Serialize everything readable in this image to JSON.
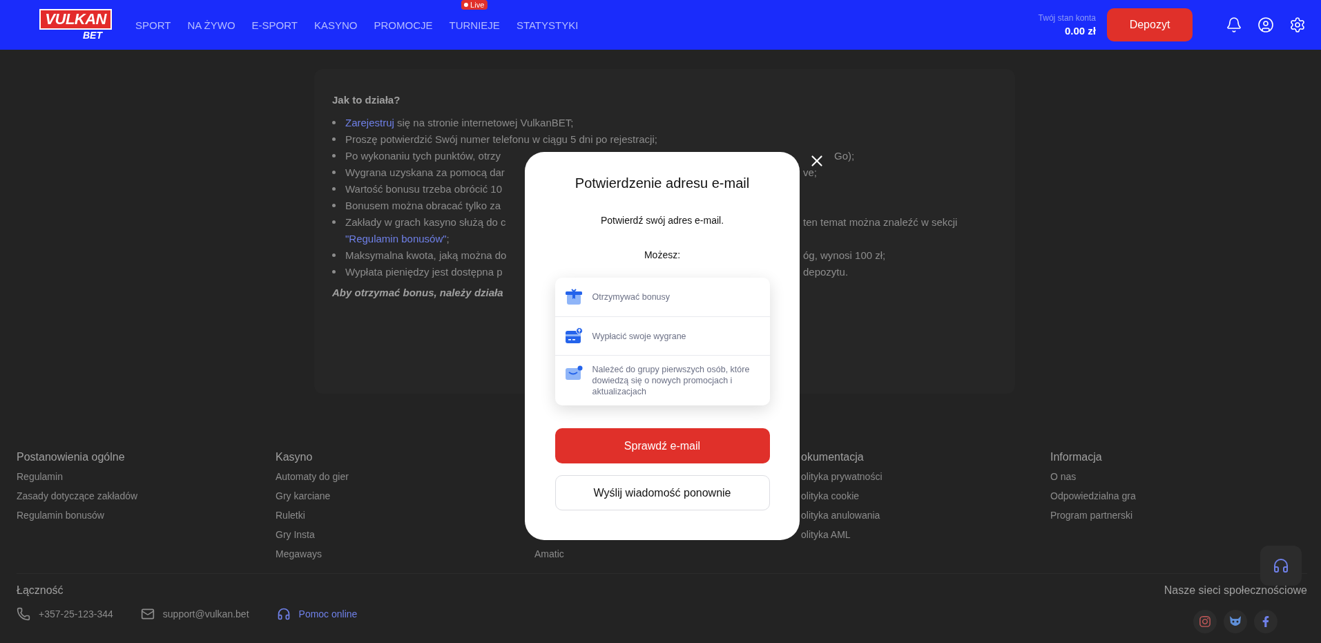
{
  "header": {
    "logo": {
      "wordmark": "VULKAN",
      "subtext": "BET"
    },
    "nav": [
      {
        "label": "SPORT"
      },
      {
        "label": "NA ŻYWO"
      },
      {
        "label": "E-SPORT"
      },
      {
        "label": "KASYNO"
      },
      {
        "label": "PROMOCJE"
      },
      {
        "label": "TURNIEJE",
        "badge": "Live"
      },
      {
        "label": "STATYSTYKI"
      }
    ],
    "balance": {
      "label": "Twój stan konta",
      "amount": "0.00 zł"
    },
    "deposit_button": "Depozyt"
  },
  "promo": {
    "heading": "Jak to działa?",
    "bullets": [
      {
        "link": "Zarejestruj",
        "text": " się na stronie internetowej VulkanBET;"
      },
      {
        "text": "Proszę potwierdzić Swój numer telefonu w ciągu 5 dni po rejestracji;"
      },
      {
        "text": "Po wykonaniu tych punktów, otrzy",
        "right": "Go);"
      },
      {
        "text": "Wygrana uzyskana za pomocą dar",
        "right": "ve;"
      },
      {
        "text": "Wartość bonusu trzeba obrócić 10"
      },
      {
        "text": "Bonusem można obracać tylko za"
      },
      {
        "text": "Zakłady w grach kasyno służą do c",
        "right": "ten temat można znaleźć w sekcji",
        "continuation": {
          "link": "\"Regulamin bonusów\"",
          "text": ";"
        }
      },
      {
        "text": "Maksymalna kwota, jaką można do",
        "right": "óg, wynosi 100 zł;"
      },
      {
        "text": "Wypłata pieniędzy jest dostępna p",
        "right": "depozytu."
      }
    ],
    "note": "Aby otrzymać bonus, należy działa"
  },
  "footer": {
    "columns": [
      {
        "heading": "Postanowienia ogólne",
        "items": [
          "Regulamin",
          "Zasady dotyczące zakładów",
          "Regulamin bonusów"
        ]
      },
      {
        "heading": "Kasyno",
        "items": [
          "Automaty do gier",
          "Gry karciane",
          "Ruletki",
          "Gry Insta",
          "Megaways"
        ]
      },
      {
        "items": [
          "Amatic"
        ]
      },
      {
        "heading": "okumentacja",
        "items": [
          "olityka prywatności",
          "olityka cookie",
          "olityka anulowania",
          "olityka AML"
        ]
      },
      {
        "heading": "Informacja",
        "items": [
          "O nas",
          "Odpowiedzialna gra",
          "Program partnerski"
        ]
      }
    ],
    "contact": {
      "heading": "Łączność",
      "items": [
        {
          "kind": "phone",
          "text": "+357-25-123-344"
        },
        {
          "kind": "email",
          "text": "support@vulkan.bet"
        },
        {
          "kind": "chat",
          "text": "Pomoc online"
        }
      ]
    },
    "social": {
      "heading": "Nasze sieci społecznościowe",
      "links": [
        {
          "kind": "instagram"
        },
        {
          "kind": "mascot"
        },
        {
          "kind": "facebook"
        }
      ]
    }
  },
  "modal": {
    "title": "Potwierdzenie adresu e-mail",
    "message": "Potwierdź swój adres e-mail.",
    "list_heading": "Możesz:",
    "benefits": [
      {
        "kind": "gift",
        "text": "Otrzymywać bonusy"
      },
      {
        "kind": "card",
        "text": "Wypłacić swoje wygrane"
      },
      {
        "kind": "mail",
        "text": "Należeć do grupy pierwszych osób, które dowiedzą się o nowych promocjach i aktualizacjach"
      }
    ],
    "primary_button": "Sprawdź e-mail",
    "secondary_button": "Wyślij wiadomość ponownie"
  }
}
